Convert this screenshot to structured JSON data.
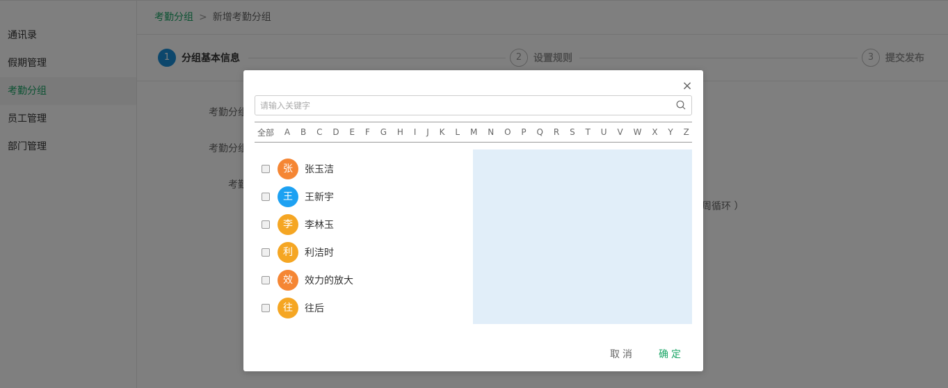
{
  "sidebar": {
    "items": [
      {
        "label": "通讯录"
      },
      {
        "label": "假期管理"
      },
      {
        "label": "考勤分组"
      },
      {
        "label": "员工管理"
      },
      {
        "label": "部门管理"
      }
    ]
  },
  "breadcrumb": {
    "parent": "考勤分组",
    "separator": ">",
    "current": "新增考勤分组"
  },
  "steps": [
    {
      "num": "1",
      "label": "分组基本信息"
    },
    {
      "num": "2",
      "label": "设置规则"
    },
    {
      "num": "3",
      "label": "提交发布"
    }
  ],
  "form": {
    "label1": "考勤分组",
    "label2": "考勤分组",
    "label3": "考勤",
    "side_text": "周循环 ）"
  },
  "modal": {
    "search_placeholder": "请输入关键字",
    "alphabet": [
      "全部",
      "A",
      "B",
      "C",
      "D",
      "E",
      "F",
      "G",
      "H",
      "I",
      "J",
      "K",
      "L",
      "M",
      "N",
      "O",
      "P",
      "Q",
      "R",
      "S",
      "T",
      "U",
      "V",
      "W",
      "X",
      "Y",
      "Z"
    ],
    "users": [
      {
        "initial": "张",
        "name": "张玉洁",
        "color": "#f58634"
      },
      {
        "initial": "王",
        "name": "王新宇",
        "color": "#1da1f2"
      },
      {
        "initial": "李",
        "name": "李林玉",
        "color": "#f5a623"
      },
      {
        "initial": "利",
        "name": "利洁时",
        "color": "#f5a623"
      },
      {
        "initial": "效",
        "name": "效力的放大",
        "color": "#f58634"
      },
      {
        "initial": "往",
        "name": "往后",
        "color": "#f5a623"
      }
    ],
    "cancel_label": "取消",
    "ok_label": "确定"
  },
  "colors": {
    "accent": "#1aa566",
    "step_active": "#1a8fd8",
    "selected_panel": "#e1eef9"
  }
}
